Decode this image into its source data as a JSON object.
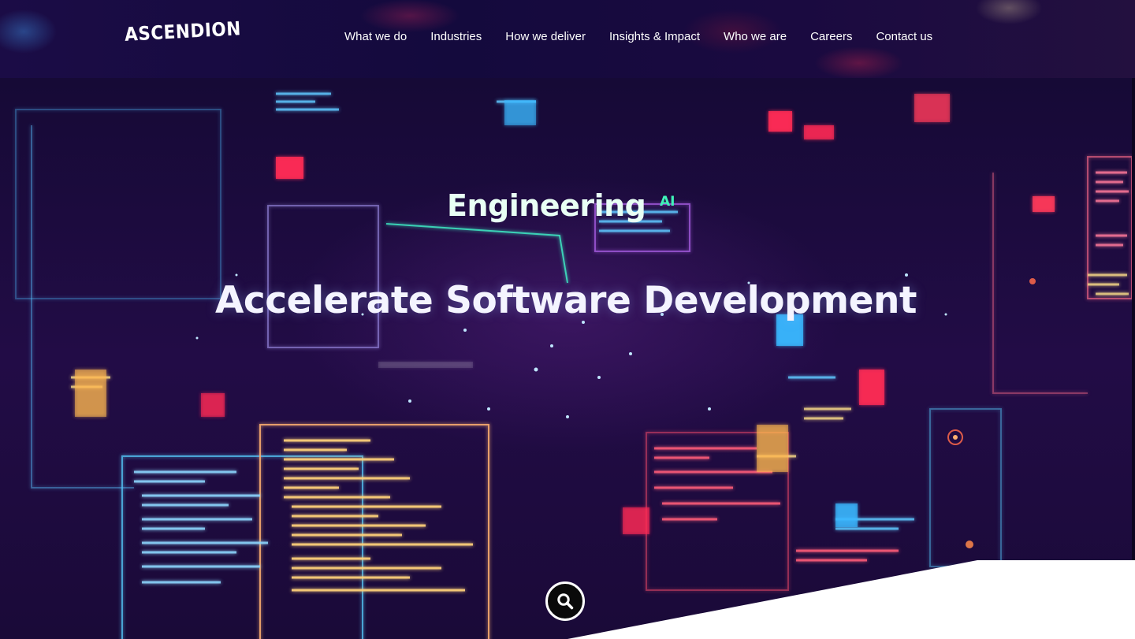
{
  "header": {
    "logo_text": "ASCENDION",
    "nav": [
      {
        "label": "What we do"
      },
      {
        "label": "Industries"
      },
      {
        "label": "How we deliver"
      },
      {
        "label": "Insights & Impact"
      },
      {
        "label": "Who we are"
      },
      {
        "label": "Careers"
      },
      {
        "label": "Contact us"
      }
    ]
  },
  "hero": {
    "kicker": "Engineering",
    "kicker_superscript": "AI",
    "headline": "Accelerate Software Development",
    "search_icon": "search-icon"
  },
  "colors": {
    "header_bg": "#170b42",
    "hero_bg": "#1f0c44",
    "ai_accent": "#3ff3b8",
    "text": "#ffffff",
    "search_button_bg": "#0a0a0a"
  }
}
